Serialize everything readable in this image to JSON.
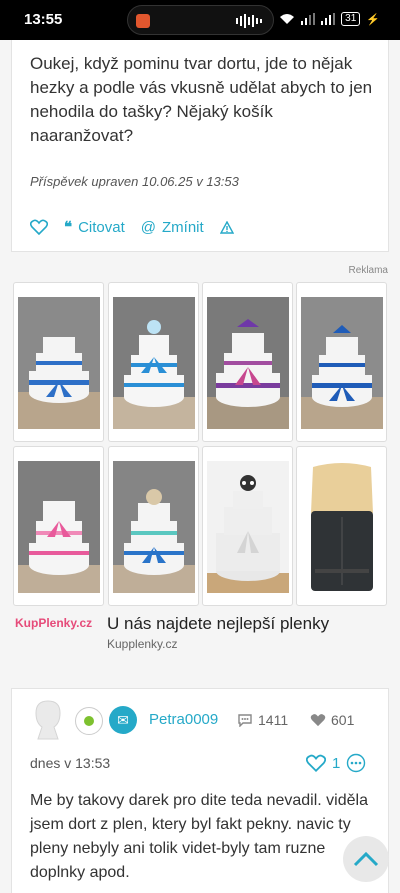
{
  "status_bar": {
    "time": "13:55",
    "battery": "31"
  },
  "post1": {
    "text": "Oukej, když pominu tvar dortu, jde to nějak hezky a podle vás vkusně udělat abych to jen nehodila do tašky? Nějaký košík naaranžovat?",
    "edited": "Příspěvek upraven 10.06.25 v 13:53",
    "quote_label": "Citovat",
    "mention_label": "Zmínit"
  },
  "ad_label": "Reklama",
  "ad": {
    "brand": "KupPlenky.cz",
    "headline": "U nás najdete nejlepší plenky",
    "domain": "Kupplenky.cz"
  },
  "post2": {
    "username": "Petra0009",
    "comments_count": "1411",
    "hearts_count": "601",
    "date": "dnes v 13:53",
    "likes": "1",
    "text": "Me by takovy darek pro dite teda nevadil. viděla jsem dort z plen, ktery byl fakt pekny. navic ty pleny nebyly ani tolik videt-byly tam ruzne doplnky apod."
  },
  "colors": {
    "accent": "#25a9c8",
    "brand_pink": "#e64b7a",
    "online": "#7dc12f"
  }
}
